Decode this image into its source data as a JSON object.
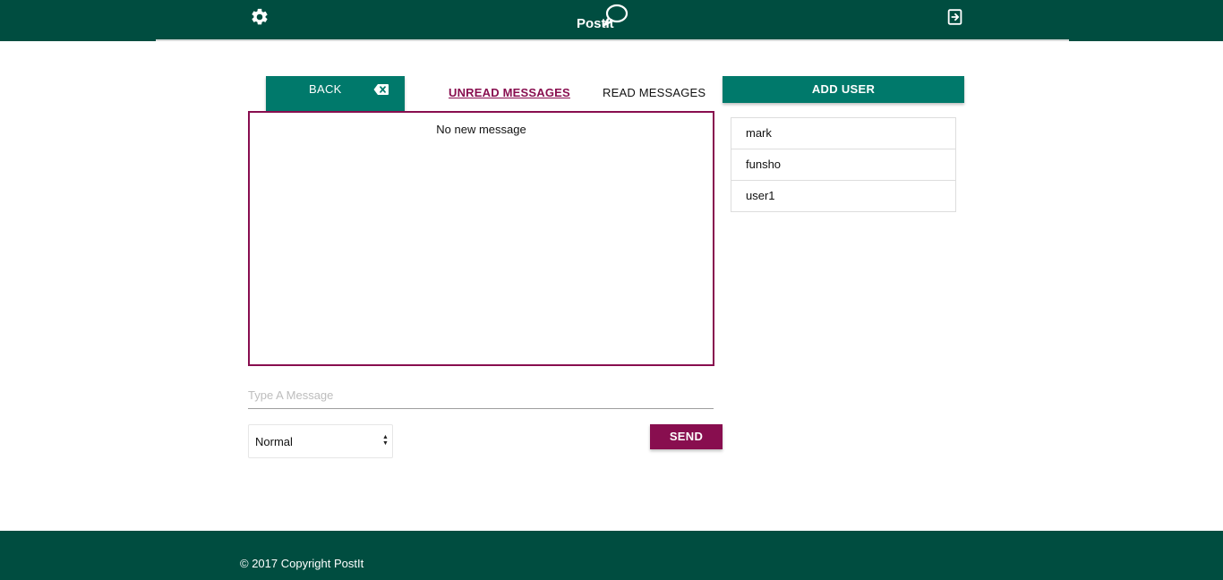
{
  "header": {
    "logo_text": "PostIt",
    "settings_icon": "gear-icon",
    "logout_icon": "logout-icon",
    "bg_color": "#004d40"
  },
  "toolbar": {
    "back_label": "BACK",
    "back_icon": "backspace-icon",
    "tabs": [
      {
        "label": "UNREAD MESSAGES",
        "active": true
      },
      {
        "label": "READ MESSAGES",
        "active": false
      }
    ],
    "add_user_label": "ADD USER"
  },
  "messages": {
    "empty_text": "No new message"
  },
  "users": [
    {
      "name": "mark"
    },
    {
      "name": "funsho"
    },
    {
      "name": "user1"
    }
  ],
  "composer": {
    "placeholder": "Type A Message",
    "value": "",
    "priority_selected": "Normal",
    "send_label": "SEND"
  },
  "footer": {
    "copyright": "© 2017 Copyright PostIt"
  },
  "colors": {
    "primary": "#004d40",
    "accent": "#00796b",
    "secondary": "#880e4f"
  }
}
